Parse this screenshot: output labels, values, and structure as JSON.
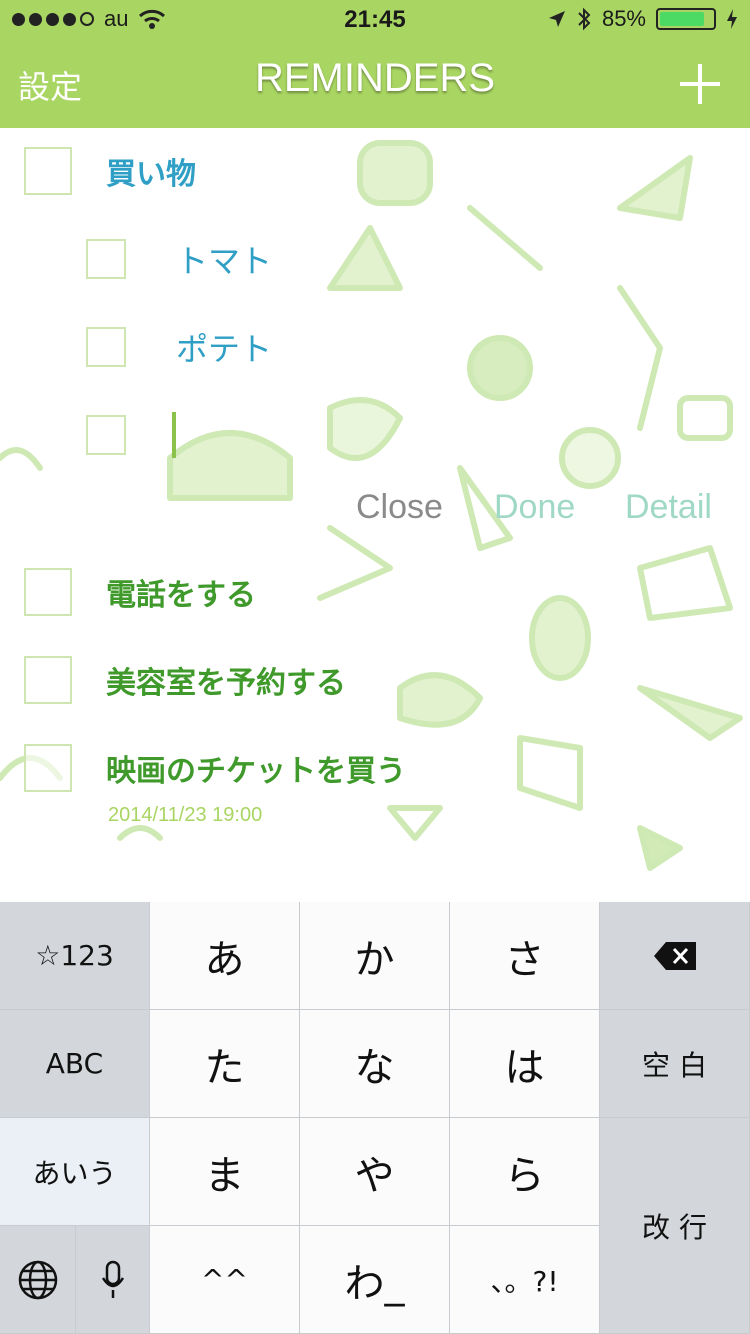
{
  "status_bar": {
    "carrier": "au",
    "time": "21:45",
    "battery": "85%",
    "battery_level": 0.85
  },
  "nav": {
    "left": "設定",
    "title": "REMINDERS",
    "add_icon": "plus-icon"
  },
  "reminders": {
    "list": [
      {
        "label": "買い物",
        "color": "#2f9fc5"
      },
      {
        "label": "電話をする",
        "color": "#3f9a2b"
      },
      {
        "label": "美容室を予約する",
        "color": "#3f9a2b"
      },
      {
        "label": "映画のチケットを買う",
        "color": "#3f9a2b",
        "date": "2014/11/23 19:00"
      }
    ],
    "subitems": [
      {
        "label": "トマト"
      },
      {
        "label": "ポテト"
      }
    ],
    "actions": {
      "close": "Close",
      "done": "Done",
      "detail": "Detail"
    }
  },
  "keyboard": {
    "mode_num": "☆123",
    "mode_abc": "ABC",
    "mode_kana": "あいう",
    "row1": [
      "あ",
      "か",
      "さ"
    ],
    "row2": [
      "た",
      "な",
      "は"
    ],
    "row3": [
      "ま",
      "や",
      "ら"
    ],
    "row4": [
      "^^",
      "わ_",
      "、。?!"
    ],
    "space": "空 白",
    "return": "改 行",
    "globe_icon": "globe-icon",
    "mic_icon": "microphone-icon",
    "backspace_icon": "backspace-icon"
  },
  "colors": {
    "accent": "#a9d562",
    "blue_text": "#2f9fc5",
    "green_text": "#3f9a2b"
  }
}
